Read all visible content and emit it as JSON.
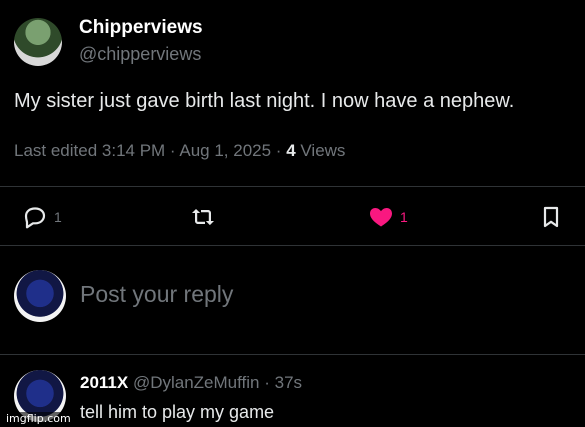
{
  "post": {
    "display_name": "Chipperviews",
    "handle": "@chipperviews",
    "text": "My sister just gave birth last night. I now have a nephew.",
    "meta_prefix": "Last edited 3:14 PM · Aug 1, 2025 · ",
    "views_count": "4",
    "views_label": " Views"
  },
  "actions": {
    "reply_count": "1",
    "retweet_count": "",
    "like_count": "1",
    "like_color": "#f91880"
  },
  "composer": {
    "placeholder": "Post your reply"
  },
  "comment": {
    "name": "2011X",
    "handle_time": " @DylanZeMuffin · 37s",
    "text": "tell him to play my game"
  },
  "watermark": "imgflip.com"
}
